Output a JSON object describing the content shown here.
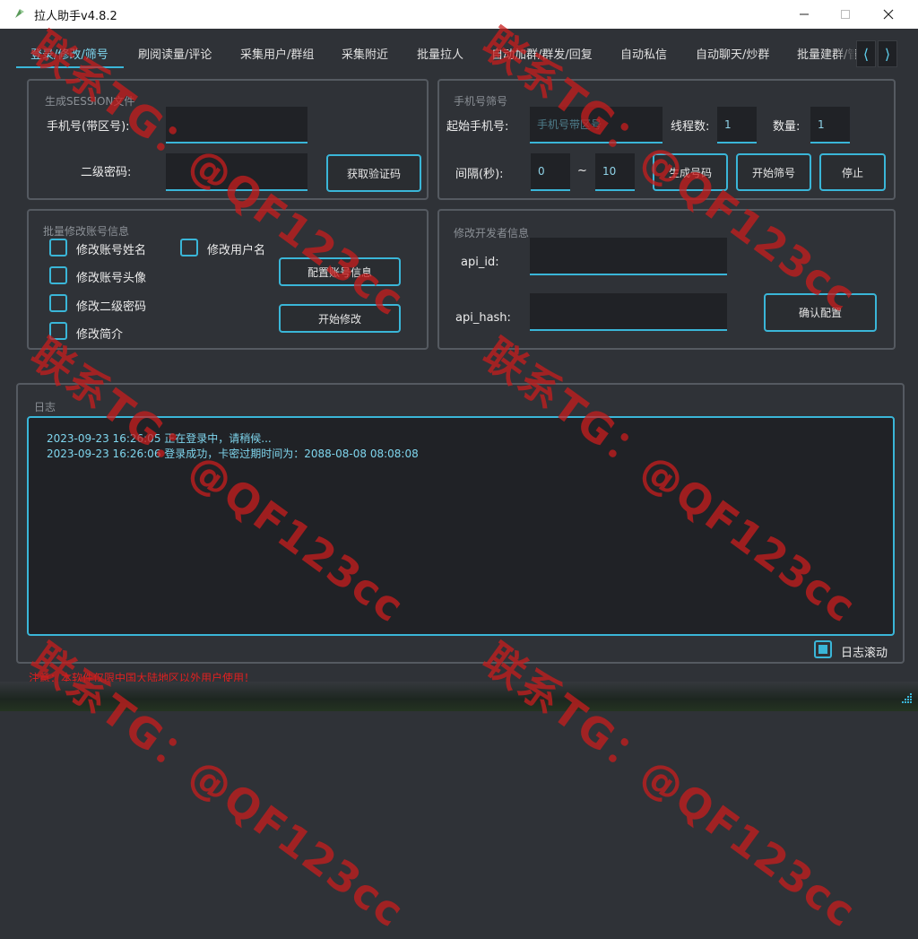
{
  "window": {
    "title": "拉人助手v4.8.2"
  },
  "tabs": [
    "登录/修改/筛号",
    "刷阅读量/评论",
    "采集用户/群组",
    "采集附近",
    "批量拉人",
    "自动加群/群发/回复",
    "自动私信",
    "自动聊天/炒群",
    "批量建群/管"
  ],
  "session_panel": {
    "title": "生成SESSION文件",
    "phone_label": "手机号(带区号):",
    "phone_value": "",
    "password_label": "二级密码:",
    "password_value": "",
    "get_code_button": "获取验证码"
  },
  "filter_panel": {
    "title": "手机号筛号",
    "start_phone_label": "起始手机号:",
    "start_phone_placeholder": "手机号带区号",
    "threads_label": "线程数:",
    "threads_value": "1",
    "count_label": "数量:",
    "count_value": "1",
    "interval_label": "间隔(秒):",
    "interval_min": "0",
    "interval_sep": "~",
    "interval_max": "10",
    "generate_button": "生成号码",
    "start_button": "开始筛号",
    "stop_button": "停止"
  },
  "batch_panel": {
    "title": "批量修改账号信息",
    "options": {
      "name": "修改账号姓名",
      "username": "修改用户名",
      "avatar": "修改账号头像",
      "password": "修改二级密码",
      "bio": "修改简介"
    },
    "config_button": "配置账号信息",
    "start_button": "开始修改"
  },
  "dev_panel": {
    "title": "修改开发者信息",
    "api_id_label": "api_id:",
    "api_id_value": "",
    "api_hash_label": "api_hash:",
    "api_hash_value": "",
    "confirm_button": "确认配置"
  },
  "log_panel": {
    "title": "日志",
    "lines": [
      "2023-09-23 16:26:05 正在登录中，请稍候...",
      "2023-09-23 16:26:06 登录成功，卡密过期时间为：2088-08-08 08:08:08"
    ],
    "scroll_label": "日志滚动"
  },
  "notice": "注意：本软件仅限中国大陆地区以外用户使用！",
  "watermark": "联系TG：@QF123cc",
  "colors": {
    "accent": "#3ab6d8",
    "background": "#2f3237",
    "warning": "#e02020"
  }
}
